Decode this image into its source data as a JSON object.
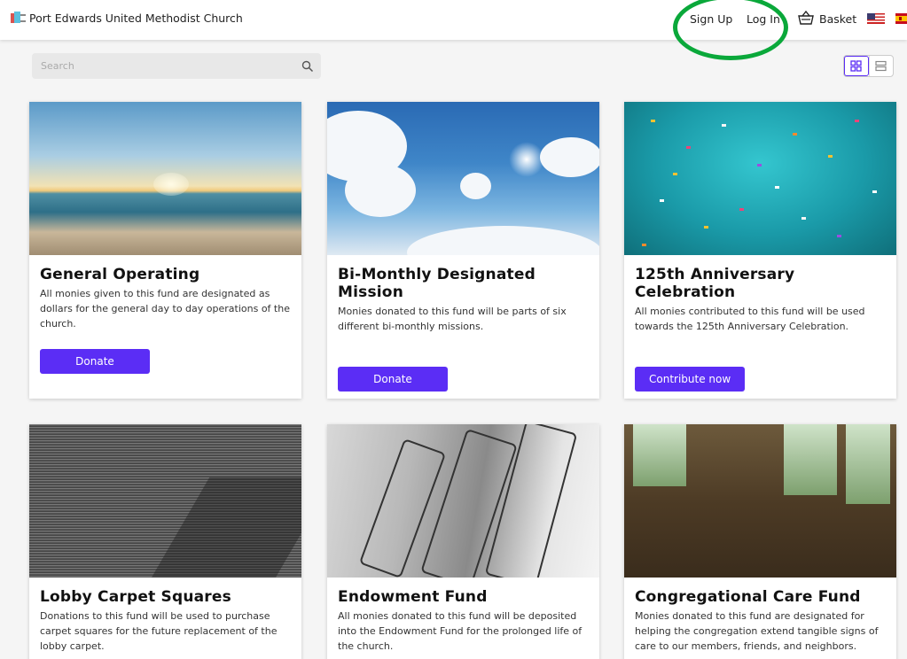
{
  "header": {
    "brand_name": "Port Edwards United Methodist Church",
    "sign_up": "Sign Up",
    "log_in": "Log In",
    "basket": "Basket"
  },
  "search": {
    "placeholder": "Search"
  },
  "cards": [
    {
      "title": "General Operating",
      "description": "All monies given to this fund are designated as dollars for the general day to day operations of the church.",
      "button": "Donate"
    },
    {
      "title": "Bi-Monthly Designated Mission",
      "description": "Monies donated to this fund will be parts of six different bi-monthly missions.",
      "button": "Donate"
    },
    {
      "title": "125th Anniversary Celebration",
      "description": "All monies contributed to this fund will be used towards the 125th Anniversary Celebration.",
      "button": "Contribute now"
    },
    {
      "title": "Lobby Carpet Squares",
      "description": "Donations to this fund will be used to purchase carpet squares for the future replacement of the lobby carpet."
    },
    {
      "title": "Endowment Fund",
      "description": "All monies donated to this fund will be deposited into the Endowment Fund for the prolonged life of the church."
    },
    {
      "title": "Congregational Care Fund",
      "description": "Monies donated to this fund are designated for helping the congregation extend tangible signs of care to our members, friends, and neighbors."
    }
  ],
  "colors": {
    "accent": "#5b2df5",
    "highlight_ring": "#0aa83a"
  }
}
